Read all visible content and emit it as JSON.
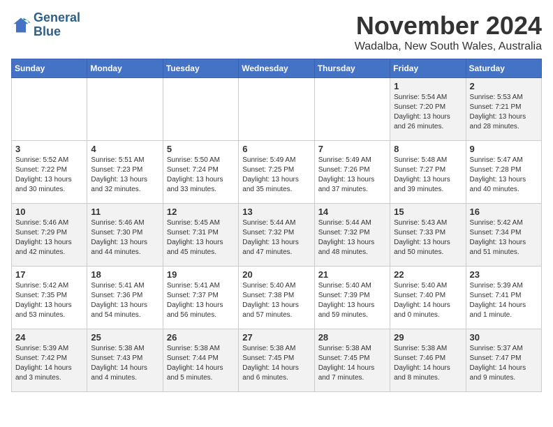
{
  "logo": {
    "line1": "General",
    "line2": "Blue"
  },
  "title": "November 2024",
  "location": "Wadalba, New South Wales, Australia",
  "headers": [
    "Sunday",
    "Monday",
    "Tuesday",
    "Wednesday",
    "Thursday",
    "Friday",
    "Saturday"
  ],
  "weeks": [
    [
      {
        "day": "",
        "content": ""
      },
      {
        "day": "",
        "content": ""
      },
      {
        "day": "",
        "content": ""
      },
      {
        "day": "",
        "content": ""
      },
      {
        "day": "",
        "content": ""
      },
      {
        "day": "1",
        "content": "Sunrise: 5:54 AM\nSunset: 7:20 PM\nDaylight: 13 hours\nand 26 minutes."
      },
      {
        "day": "2",
        "content": "Sunrise: 5:53 AM\nSunset: 7:21 PM\nDaylight: 13 hours\nand 28 minutes."
      }
    ],
    [
      {
        "day": "3",
        "content": "Sunrise: 5:52 AM\nSunset: 7:22 PM\nDaylight: 13 hours\nand 30 minutes."
      },
      {
        "day": "4",
        "content": "Sunrise: 5:51 AM\nSunset: 7:23 PM\nDaylight: 13 hours\nand 32 minutes."
      },
      {
        "day": "5",
        "content": "Sunrise: 5:50 AM\nSunset: 7:24 PM\nDaylight: 13 hours\nand 33 minutes."
      },
      {
        "day": "6",
        "content": "Sunrise: 5:49 AM\nSunset: 7:25 PM\nDaylight: 13 hours\nand 35 minutes."
      },
      {
        "day": "7",
        "content": "Sunrise: 5:49 AM\nSunset: 7:26 PM\nDaylight: 13 hours\nand 37 minutes."
      },
      {
        "day": "8",
        "content": "Sunrise: 5:48 AM\nSunset: 7:27 PM\nDaylight: 13 hours\nand 39 minutes."
      },
      {
        "day": "9",
        "content": "Sunrise: 5:47 AM\nSunset: 7:28 PM\nDaylight: 13 hours\nand 40 minutes."
      }
    ],
    [
      {
        "day": "10",
        "content": "Sunrise: 5:46 AM\nSunset: 7:29 PM\nDaylight: 13 hours\nand 42 minutes."
      },
      {
        "day": "11",
        "content": "Sunrise: 5:46 AM\nSunset: 7:30 PM\nDaylight: 13 hours\nand 44 minutes."
      },
      {
        "day": "12",
        "content": "Sunrise: 5:45 AM\nSunset: 7:31 PM\nDaylight: 13 hours\nand 45 minutes."
      },
      {
        "day": "13",
        "content": "Sunrise: 5:44 AM\nSunset: 7:32 PM\nDaylight: 13 hours\nand 47 minutes."
      },
      {
        "day": "14",
        "content": "Sunrise: 5:44 AM\nSunset: 7:32 PM\nDaylight: 13 hours\nand 48 minutes."
      },
      {
        "day": "15",
        "content": "Sunrise: 5:43 AM\nSunset: 7:33 PM\nDaylight: 13 hours\nand 50 minutes."
      },
      {
        "day": "16",
        "content": "Sunrise: 5:42 AM\nSunset: 7:34 PM\nDaylight: 13 hours\nand 51 minutes."
      }
    ],
    [
      {
        "day": "17",
        "content": "Sunrise: 5:42 AM\nSunset: 7:35 PM\nDaylight: 13 hours\nand 53 minutes."
      },
      {
        "day": "18",
        "content": "Sunrise: 5:41 AM\nSunset: 7:36 PM\nDaylight: 13 hours\nand 54 minutes."
      },
      {
        "day": "19",
        "content": "Sunrise: 5:41 AM\nSunset: 7:37 PM\nDaylight: 13 hours\nand 56 minutes."
      },
      {
        "day": "20",
        "content": "Sunrise: 5:40 AM\nSunset: 7:38 PM\nDaylight: 13 hours\nand 57 minutes."
      },
      {
        "day": "21",
        "content": "Sunrise: 5:40 AM\nSunset: 7:39 PM\nDaylight: 13 hours\nand 59 minutes."
      },
      {
        "day": "22",
        "content": "Sunrise: 5:40 AM\nSunset: 7:40 PM\nDaylight: 14 hours\nand 0 minutes."
      },
      {
        "day": "23",
        "content": "Sunrise: 5:39 AM\nSunset: 7:41 PM\nDaylight: 14 hours\nand 1 minute."
      }
    ],
    [
      {
        "day": "24",
        "content": "Sunrise: 5:39 AM\nSunset: 7:42 PM\nDaylight: 14 hours\nand 3 minutes."
      },
      {
        "day": "25",
        "content": "Sunrise: 5:38 AM\nSunset: 7:43 PM\nDaylight: 14 hours\nand 4 minutes."
      },
      {
        "day": "26",
        "content": "Sunrise: 5:38 AM\nSunset: 7:44 PM\nDaylight: 14 hours\nand 5 minutes."
      },
      {
        "day": "27",
        "content": "Sunrise: 5:38 AM\nSunset: 7:45 PM\nDaylight: 14 hours\nand 6 minutes."
      },
      {
        "day": "28",
        "content": "Sunrise: 5:38 AM\nSunset: 7:45 PM\nDaylight: 14 hours\nand 7 minutes."
      },
      {
        "day": "29",
        "content": "Sunrise: 5:38 AM\nSunset: 7:46 PM\nDaylight: 14 hours\nand 8 minutes."
      },
      {
        "day": "30",
        "content": "Sunrise: 5:37 AM\nSunset: 7:47 PM\nDaylight: 14 hours\nand 9 minutes."
      }
    ]
  ]
}
